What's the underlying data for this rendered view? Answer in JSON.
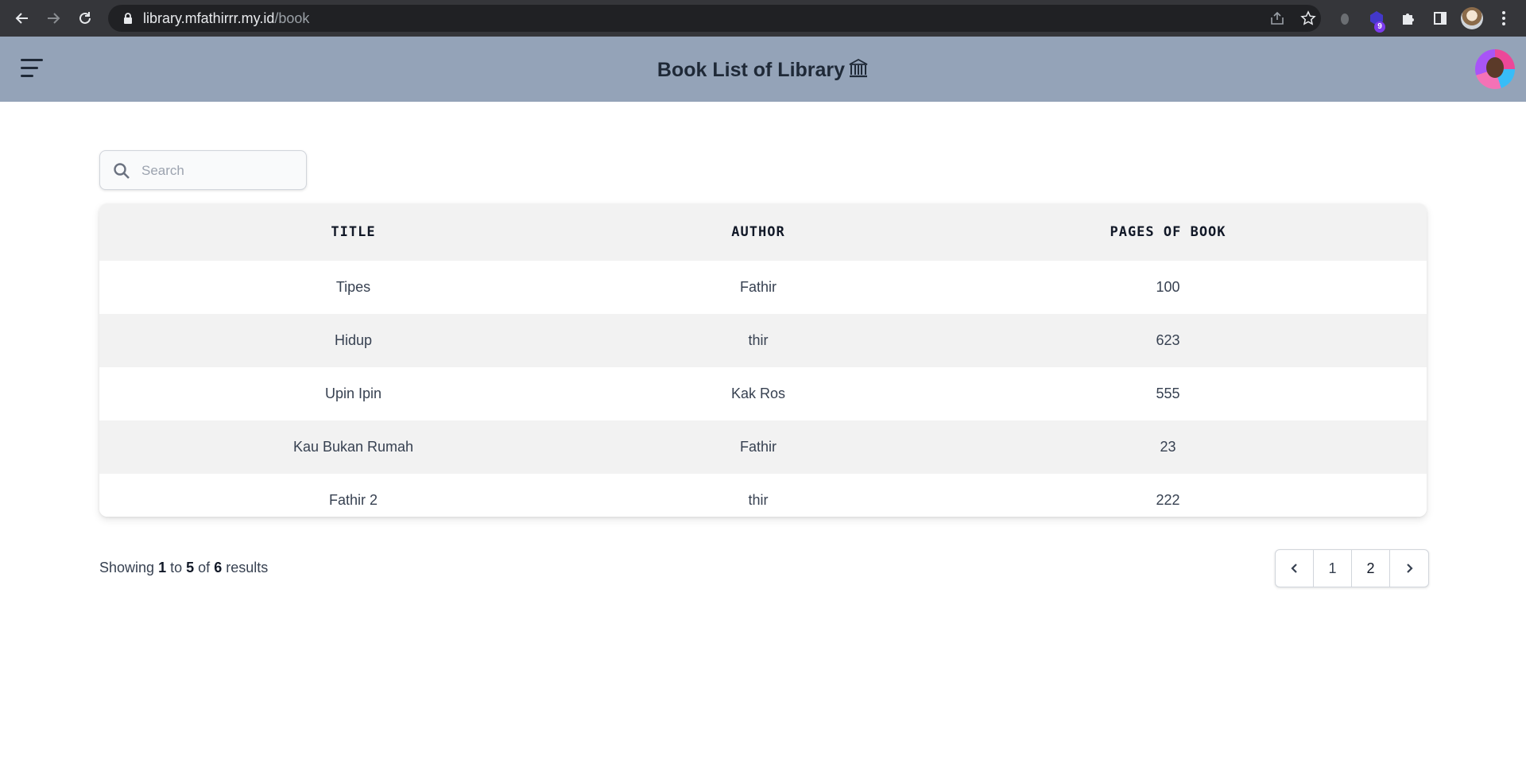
{
  "browser": {
    "url_host": "library.mfathirrr.my.id",
    "url_path": "/book",
    "extension_badge": "9"
  },
  "header": {
    "title": "Book List of Library",
    "title_emoji": "🏛"
  },
  "search": {
    "placeholder": "Search",
    "value": ""
  },
  "table": {
    "columns": [
      "TITLE",
      "AUTHOR",
      "PAGES OF BOOK"
    ],
    "rows": [
      {
        "title": "Tipes",
        "author": "Fathir",
        "pages": "100"
      },
      {
        "title": "Hidup",
        "author": "thir",
        "pages": "623"
      },
      {
        "title": "Upin Ipin",
        "author": "Kak Ros",
        "pages": "555"
      },
      {
        "title": "Kau Bukan Rumah",
        "author": "Fathir",
        "pages": "23"
      },
      {
        "title": "Fathir 2",
        "author": "thir",
        "pages": "222"
      }
    ]
  },
  "footer": {
    "showing_prefix": "Showing",
    "from": "1",
    "to_word": "to",
    "to": "5",
    "of_word": "of",
    "total": "6",
    "suffix": "results"
  },
  "pagination": {
    "pages": [
      "1",
      "2"
    ]
  },
  "colors": {
    "header_bg": "#94a3b8",
    "table_header_bg": "#f2f2f2",
    "browser_bg": "#35363a"
  }
}
